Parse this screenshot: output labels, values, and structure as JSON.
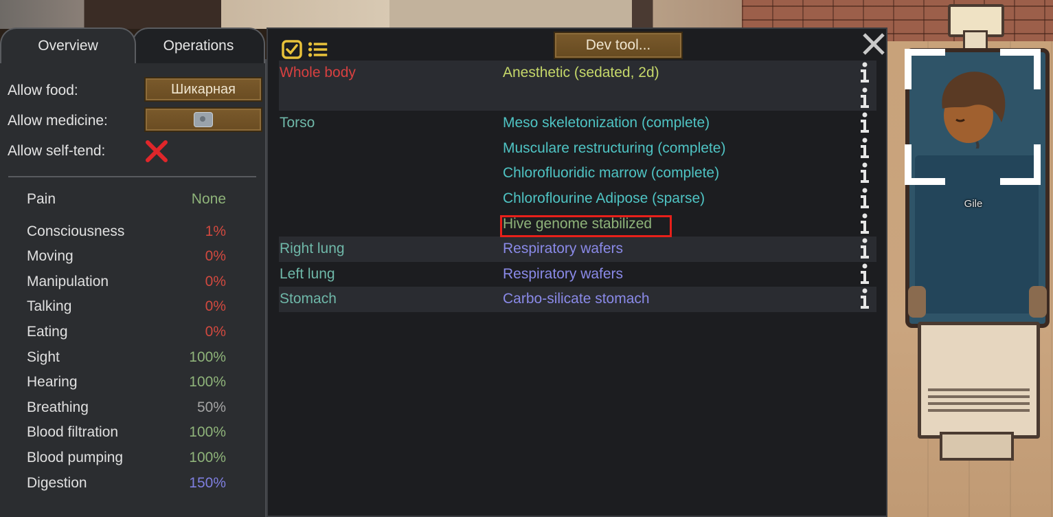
{
  "left_panel": {
    "tabs": [
      "Overview",
      "Operations"
    ],
    "allow_food_label": "Allow food:",
    "allow_food_value": "Шикарная",
    "allow_medicine_label": "Allow medicine:",
    "allow_medicine_icon": "medicine-icon",
    "allow_self_tend_label": "Allow self-tend:",
    "allow_self_tend_icon": "red-x-icon",
    "capacities": [
      {
        "name": "Pain",
        "value": "None",
        "color": "#8fb47a"
      },
      {
        "name": "Consciousness",
        "value": "1%",
        "color": "#d2493f"
      },
      {
        "name": "Moving",
        "value": "0%",
        "color": "#d2493f"
      },
      {
        "name": "Manipulation",
        "value": "0%",
        "color": "#d2493f"
      },
      {
        "name": "Talking",
        "value": "0%",
        "color": "#d2493f"
      },
      {
        "name": "Eating",
        "value": "0%",
        "color": "#d2493f"
      },
      {
        "name": "Sight",
        "value": "100%",
        "color": "#8fb47a"
      },
      {
        "name": "Hearing",
        "value": "100%",
        "color": "#8fb47a"
      },
      {
        "name": "Breathing",
        "value": "50%",
        "color": "#a5a5a5"
      },
      {
        "name": "Blood filtration",
        "value": "100%",
        "color": "#8fb47a"
      },
      {
        "name": "Blood pumping",
        "value": "100%",
        "color": "#8fb47a"
      },
      {
        "name": "Digestion",
        "value": "150%",
        "color": "#7f7fe0"
      }
    ]
  },
  "main_panel": {
    "dev_tool_label": "Dev tool...",
    "icons": [
      "checkbox-icon",
      "list-icon",
      "close-icon",
      "info-icon"
    ],
    "rows": [
      {
        "part": "Whole body",
        "part_color": "#d84040",
        "conditions": [
          {
            "text": "Anesthetic (sedated, 2d)",
            "color": "#c6d86a"
          }
        ]
      },
      {
        "part": "Torso",
        "part_color": "#6fb8a9",
        "conditions": [
          {
            "text": "Meso skeletonization (complete)",
            "color": "#4fc4c4"
          },
          {
            "text": "Musculare restructuring (complete)",
            "color": "#4fc4c4"
          },
          {
            "text": "Chlorofluoridic marrow (complete)",
            "color": "#4fc4c4"
          },
          {
            "text": "Chloroflourine Adipose (sparse)",
            "color": "#4fc4c4"
          },
          {
            "text": "Hive genome stabilized",
            "color": "#8fb47a"
          }
        ]
      },
      {
        "part": "Right lung",
        "part_color": "#6fb8a9",
        "conditions": [
          {
            "text": "Respiratory wafers",
            "color": "#8a8ae8"
          }
        ]
      },
      {
        "part": "Left lung",
        "part_color": "#6fb8a9",
        "conditions": [
          {
            "text": "Respiratory wafers",
            "color": "#8a8ae8"
          }
        ]
      },
      {
        "part": "Stomach",
        "part_color": "#6fb8a9",
        "conditions": [
          {
            "text": "Carbo-silicate stomach",
            "color": "#8a8ae8"
          }
        ]
      }
    ]
  },
  "pawn": {
    "name": "Gile"
  }
}
